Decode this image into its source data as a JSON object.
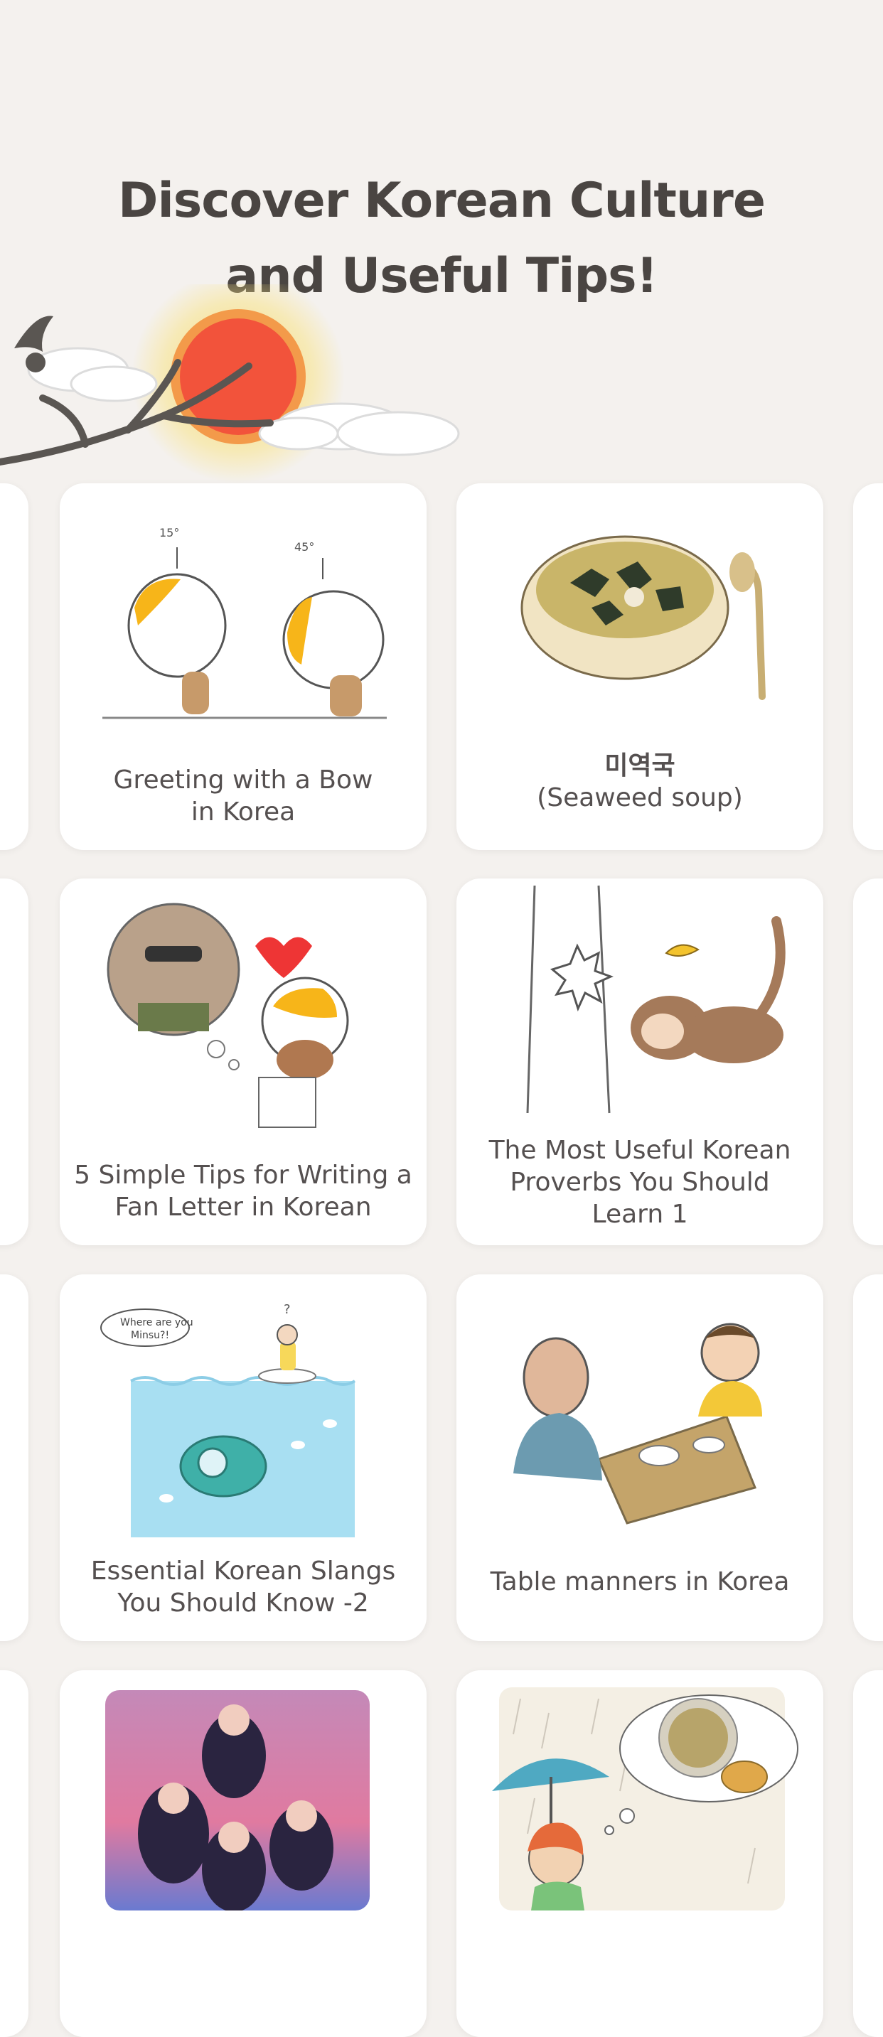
{
  "header": {
    "title_line1": "Discover Korean Culture",
    "title_line2": "and Useful Tips!"
  },
  "cards": [
    {
      "caption_line1": "Greeting with a Bow",
      "caption_line2": "in Korea",
      "icon": "bowing-eggs-illustration"
    },
    {
      "caption_line1": "미역국",
      "caption_line2": "(Seaweed soup)",
      "icon": "seaweed-soup-illustration"
    },
    {
      "caption_line1": "5 Simple Tips for Writing a",
      "caption_line2": "Fan Letter in Korean",
      "icon": "fan-letter-illustration"
    },
    {
      "caption_line1": "The Most Useful Korean",
      "caption_line2": "Proverbs You Should",
      "caption_line3": "Learn 1",
      "icon": "monkey-falling-illustration"
    },
    {
      "caption_line1": "Essential Korean Slangs",
      "caption_line2": "You Should Know -2",
      "icon": "submarine-illustration"
    },
    {
      "caption_line1": "Table manners in Korea",
      "icon": "table-manners-illustration"
    },
    {
      "icon": "kpop-group-photo"
    },
    {
      "icon": "rainy-day-pancake-illustration"
    }
  ],
  "colors": {
    "background": "#f4f1ee",
    "card": "#ffffff",
    "title_text": "#4a4542",
    "sun": "#f2533b",
    "egg_yolk": "#f7b519"
  }
}
